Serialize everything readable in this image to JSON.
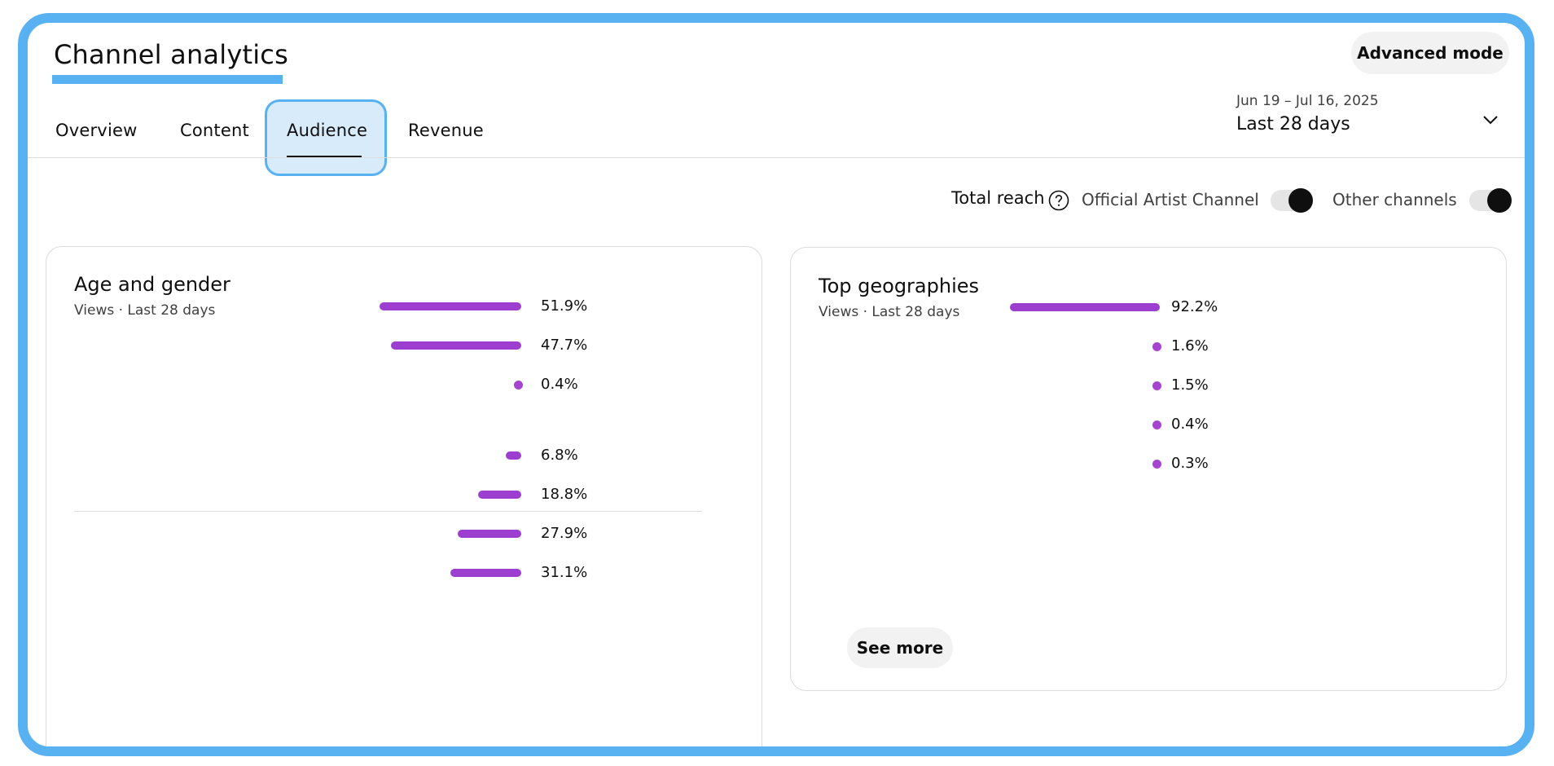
{
  "header": {
    "title": "Channel analytics",
    "advanced_mode_label": "Advanced mode"
  },
  "tabs": [
    {
      "label": "Overview"
    },
    {
      "label": "Content"
    },
    {
      "label": "Audience",
      "selected": true
    },
    {
      "label": "Revenue"
    }
  ],
  "date_picker": {
    "range": "Jun 19 – Jul 16, 2025",
    "label": "Last 28 days"
  },
  "reach": {
    "label": "Total reach",
    "toggles": [
      {
        "label": "Official Artist Channel",
        "on": true
      },
      {
        "label": "Other channels",
        "on": true
      }
    ]
  },
  "age_gender": {
    "title": "Age and gender",
    "subtitle": "Views · Last 28 days",
    "gender_values": [
      51.9,
      47.7,
      0.4
    ],
    "gender_labels": [
      "51.9%",
      "47.7%",
      "0.4%"
    ],
    "age_values": [
      6.8,
      18.8,
      27.9,
      31.1
    ],
    "age_labels": [
      "6.8%",
      "18.8%",
      "27.9%",
      "31.1%"
    ]
  },
  "geographies": {
    "title": "Top geographies",
    "subtitle": "Views · Last 28 days",
    "values": [
      92.2,
      1.6,
      1.5,
      0.4,
      0.3
    ],
    "labels": [
      "92.2%",
      "1.6%",
      "1.5%",
      "0.4%",
      "0.3%"
    ],
    "see_more_label": "See more"
  },
  "colors": {
    "accent": "#58b2f2",
    "bar": "#9c3fd0"
  }
}
